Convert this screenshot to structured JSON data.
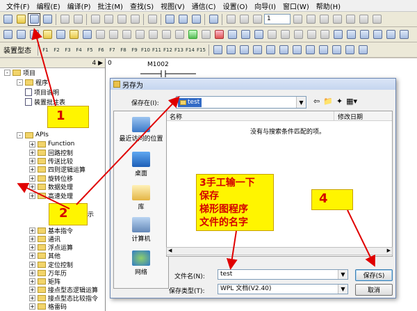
{
  "menubar": [
    "文件(F)",
    "编程(E)",
    "编译(P)",
    "批注(M)",
    "查找(S)",
    "视图(V)",
    "通信(C)",
    "设置(O)",
    "向导(I)",
    "窗口(W)",
    "帮助(H)"
  ],
  "toolbar": {
    "spin_value": "1",
    "tb3_label": "装置型态",
    "fkeys": [
      "F1",
      "F2",
      "F3",
      "F4",
      "F5",
      "F6",
      "F7",
      "F8",
      "F9",
      "F10",
      "F11",
      "F12",
      "F13",
      "F14",
      "F15"
    ]
  },
  "tree": {
    "header": "4 ▶",
    "items": [
      {
        "label": "项目",
        "level": 0,
        "kind": "folder"
      },
      {
        "label": "程序",
        "level": 1,
        "kind": "folder"
      },
      {
        "label": "项目说明",
        "level": 1,
        "kind": "doc"
      },
      {
        "label": "装置批注表",
        "level": 1,
        "kind": "doc"
      },
      {
        "label": "APIs",
        "level": 1,
        "kind": "folder"
      },
      {
        "label": "Function",
        "level": 2,
        "kind": "folder"
      },
      {
        "label": "回路控制",
        "level": 2,
        "kind": "folder"
      },
      {
        "label": "传送比较",
        "level": 2,
        "kind": "folder"
      },
      {
        "label": "四则逻辑运算",
        "level": 2,
        "kind": "folder"
      },
      {
        "label": "旋转位移",
        "level": 2,
        "kind": "folder"
      },
      {
        "label": "数据处理",
        "level": 2,
        "kind": "folder"
      },
      {
        "label": "高速处理",
        "level": 2,
        "kind": "folder"
      },
      {
        "label": "基本指令",
        "level": 2,
        "kind": "folder"
      },
      {
        "label": "通讯",
        "level": 2,
        "kind": "folder"
      },
      {
        "label": "浮点运算",
        "level": 2,
        "kind": "folder"
      },
      {
        "label": "其他",
        "level": 2,
        "kind": "folder"
      },
      {
        "label": "定位控制",
        "level": 2,
        "kind": "folder"
      },
      {
        "label": "万年历",
        "level": 2,
        "kind": "folder"
      },
      {
        "label": "矩阵",
        "level": 2,
        "kind": "folder"
      },
      {
        "label": "接点型态逻辑运算",
        "level": 2,
        "kind": "folder"
      },
      {
        "label": "接点型态比较指令",
        "level": 2,
        "kind": "folder"
      },
      {
        "label": "格雷码",
        "level": 2,
        "kind": "folder"
      }
    ],
    "partial_label": "示"
  },
  "ladder": {
    "row_number": "0",
    "contact": "M1002"
  },
  "dialog": {
    "title": "另存为",
    "save_in_label": "保存在(I):",
    "save_in_value": "test",
    "places": [
      "最近访问的位置",
      "桌面",
      "库",
      "计算机",
      "网络"
    ],
    "columns": [
      "名称",
      "修改日期"
    ],
    "empty_message": "没有与搜索条件匹配的项。",
    "filename_label": "文件名(N):",
    "filename_value": "test",
    "filetype_label": "保存类型(T):",
    "filetype_value": "WPL 文档(V2.40)",
    "save_button": "保存(S)",
    "cancel_button": "取消"
  },
  "callouts": {
    "c1": "1",
    "c2": "2",
    "c3_line1": "3手工输一下",
    "c3_line2": "保存",
    "c3_line3": "梯形图程序",
    "c3_line4": "文件的名字",
    "c4": "4"
  },
  "colors": {
    "callout_bg": "#fff500",
    "callout_text": "#d40000",
    "arrow": "#e00000",
    "selection": "#316ac5"
  }
}
